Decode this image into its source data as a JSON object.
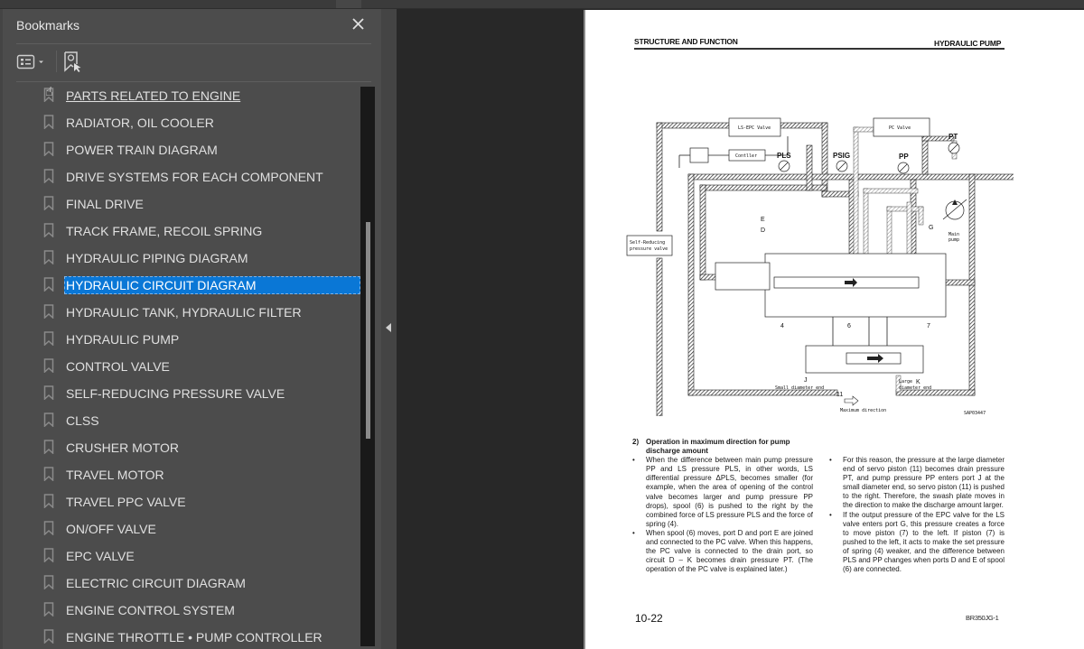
{
  "bookmarks_panel": {
    "title": "Bookmarks",
    "close_icon": "close-icon",
    "options_icon": "list-options-icon",
    "find_icon": "find-bookmark-icon",
    "items": [
      {
        "label": "PARTS RELATED TO ENGINE",
        "state": "hover"
      },
      {
        "label": "RADIATOR, OIL COOLER",
        "state": "normal"
      },
      {
        "label": "POWER TRAIN DIAGRAM",
        "state": "normal"
      },
      {
        "label": "DRIVE SYSTEMS FOR EACH COMPONENT",
        "state": "normal"
      },
      {
        "label": "FINAL DRIVE",
        "state": "normal"
      },
      {
        "label": "TRACK FRAME, RECOIL SPRING",
        "state": "normal"
      },
      {
        "label": "HYDRAULIC PIPING DIAGRAM",
        "state": "normal"
      },
      {
        "label": "HYDRAULIC CIRCUIT DIAGRAM",
        "state": "selected"
      },
      {
        "label": "HYDRAULIC TANK, HYDRAULIC FILTER",
        "state": "normal"
      },
      {
        "label": "HYDRAULIC PUMP",
        "state": "normal"
      },
      {
        "label": "CONTROL VALVE",
        "state": "normal"
      },
      {
        "label": "SELF-REDUCING PRESSURE VALVE",
        "state": "normal"
      },
      {
        "label": "CLSS",
        "state": "normal"
      },
      {
        "label": "CRUSHER MOTOR",
        "state": "normal"
      },
      {
        "label": "TRAVEL MOTOR",
        "state": "normal"
      },
      {
        "label": "TRAVEL PPC VALVE",
        "state": "normal"
      },
      {
        "label": "ON/OFF VALVE",
        "state": "normal"
      },
      {
        "label": "EPC VALVE",
        "state": "normal"
      },
      {
        "label": "ELECTRIC CIRCUIT DIAGRAM",
        "state": "normal"
      },
      {
        "label": "ENGINE CONTROL SYSTEM",
        "state": "normal"
      },
      {
        "label": "ENGINE THROTTLE • PUMP CONTROLLER",
        "state": "normal"
      }
    ],
    "accent_color": "#0a77d6"
  },
  "page": {
    "header_left": "STRUCTURE AND FUNCTION",
    "header_right": "HYDRAULIC PUMP",
    "diagram": {
      "labels": {
        "ls_epc_valve": "LS-EPC Valve",
        "controller": "Contller",
        "pls": "PLS",
        "psig": "PSIG",
        "pc_valve": "PC Valve",
        "pt": "PT",
        "pp": "PP",
        "self_reducing_1": "Self-Reducing",
        "self_reducing_2": "pressure valve",
        "main_pump_1": "Main",
        "main_pump_2": "pump",
        "e": "E",
        "d": "D",
        "g": "G",
        "n4": "4",
        "n6": "6",
        "n7": "7",
        "j": "J",
        "k": "K",
        "n11": "11",
        "small_end": "Small diameter end",
        "large_end_1": "Large",
        "large_end_2": "diameter end",
        "max_direction": "Maximum direction",
        "figure_code": "SAP03447"
      }
    },
    "section_number": "2)",
    "section_title": "Operation in maximum direction for pump discharge amount",
    "bullets_left": [
      "When the difference between main pump pressure PP and LS pressure PLS, in other words, LS differential pressure ΔPLS, becomes smaller (for example, when the area of opening of the control valve becomes larger and pump pressure PP drops), spool (6) is pushed to the right by the combined force of LS pressure PLS and the force of spring (4).",
      "When spool (6) moves, port D and port E are joined and connected to the PC valve. When this happens, the PC valve is connected to the drain port, so circuit D – K becomes drain pressure PT. (The operation of the PC valve is explained later.)"
    ],
    "bullets_right": [
      "For this reason, the pressure at the large diameter end of servo piston (11) becomes drain pressure PT, and pump pressure PP enters port J at the small diameter end, so servo piston (11) is pushed to the right. Therefore, the swash plate moves in the direction to make the discharge amount larger.",
      "If the output pressure of the EPC valve for the LS valve enters port G, this pressure creates a force to move piston (7) to the left. If piston (7) is pushed to the left, it acts to make the set pressure of spring (4) weaker, and the difference between PLS and PP changes when ports D and E of spool (6) are connected."
    ],
    "page_number": "10-22",
    "model_code": "BR350JG-1"
  }
}
